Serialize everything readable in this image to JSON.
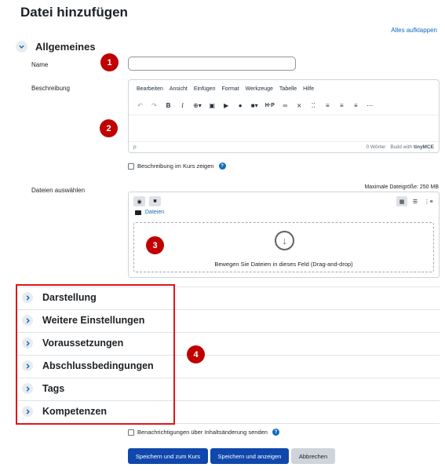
{
  "page": {
    "title": "Datei hinzufügen",
    "expand_all": "Alles aufklappen"
  },
  "general": {
    "title": "Allgemeines"
  },
  "fields": {
    "name_label": "Name",
    "name_value": "",
    "description_label": "Beschreibung",
    "files_label": "Dateien auswählen"
  },
  "editor": {
    "menu": [
      "Bearbeiten",
      "Ansicht",
      "Einfügen",
      "Format",
      "Werkzeuge",
      "Tabelle",
      "Hilfe"
    ],
    "status_path": "p",
    "word_count": "0 Wörter",
    "build_with": "Build with",
    "brand": "tinyMCE"
  },
  "show_description": "Beschreibung im Kurs zeigen",
  "filepicker": {
    "max_size": "Maximale Dateigröße: 250 MB",
    "folder": "Dateien",
    "drop_text": "Bewegen Sie Dateien in dieses Feld (Drag-and-drop)"
  },
  "badges": [
    "1",
    "2",
    "3",
    "4"
  ],
  "sections": [
    {
      "label": "Darstellung"
    },
    {
      "label": "Weitere Einstellungen"
    },
    {
      "label": "Voraussetzungen"
    },
    {
      "label": "Abschlussbedingungen"
    },
    {
      "label": "Tags"
    },
    {
      "label": "Kompetenzen"
    }
  ],
  "notify": "Benachrichtigungen über Inhaltsänderung senden",
  "buttons": {
    "save_return": "Speichern und zum Kurs",
    "save_display": "Speichern und anzeigen",
    "cancel": "Abbrechen"
  },
  "colors": {
    "primary": "#0f47ad",
    "link": "#0f6cbf",
    "badge": "#c00000",
    "highlight": "#e0161b"
  }
}
